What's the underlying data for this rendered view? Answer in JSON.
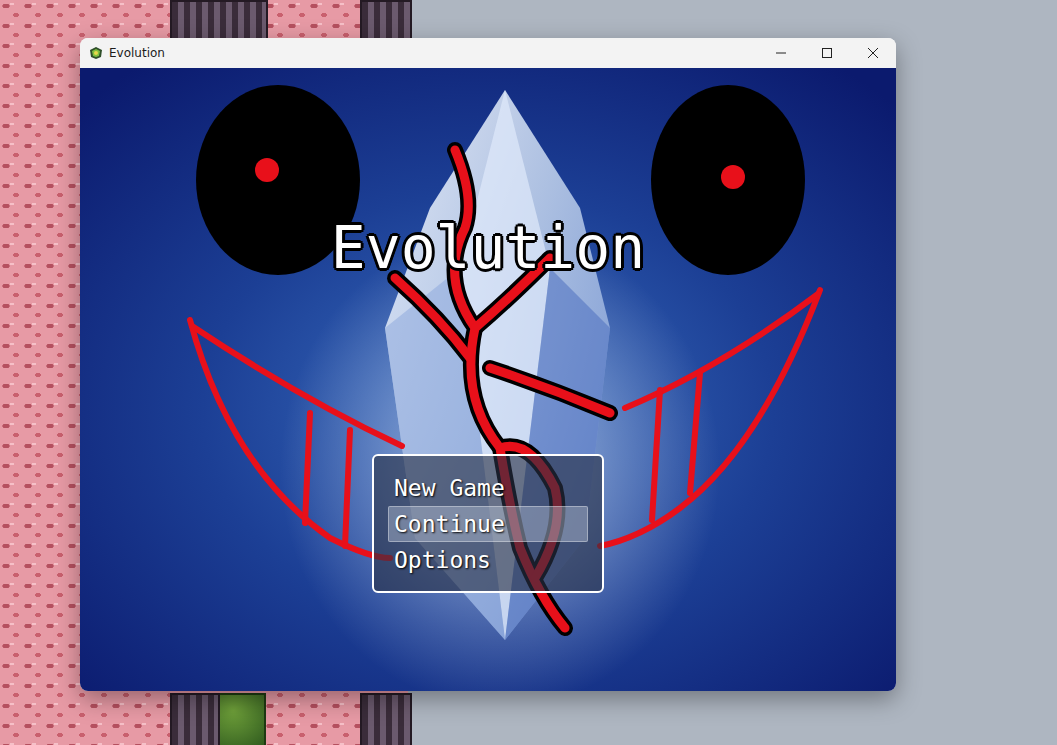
{
  "window": {
    "title": "Evolution"
  },
  "game": {
    "title": "Evolution"
  },
  "menu": [
    {
      "label": "New Game",
      "selected": false
    },
    {
      "label": "Continue",
      "selected": true
    },
    {
      "label": "Options",
      "selected": false
    }
  ]
}
